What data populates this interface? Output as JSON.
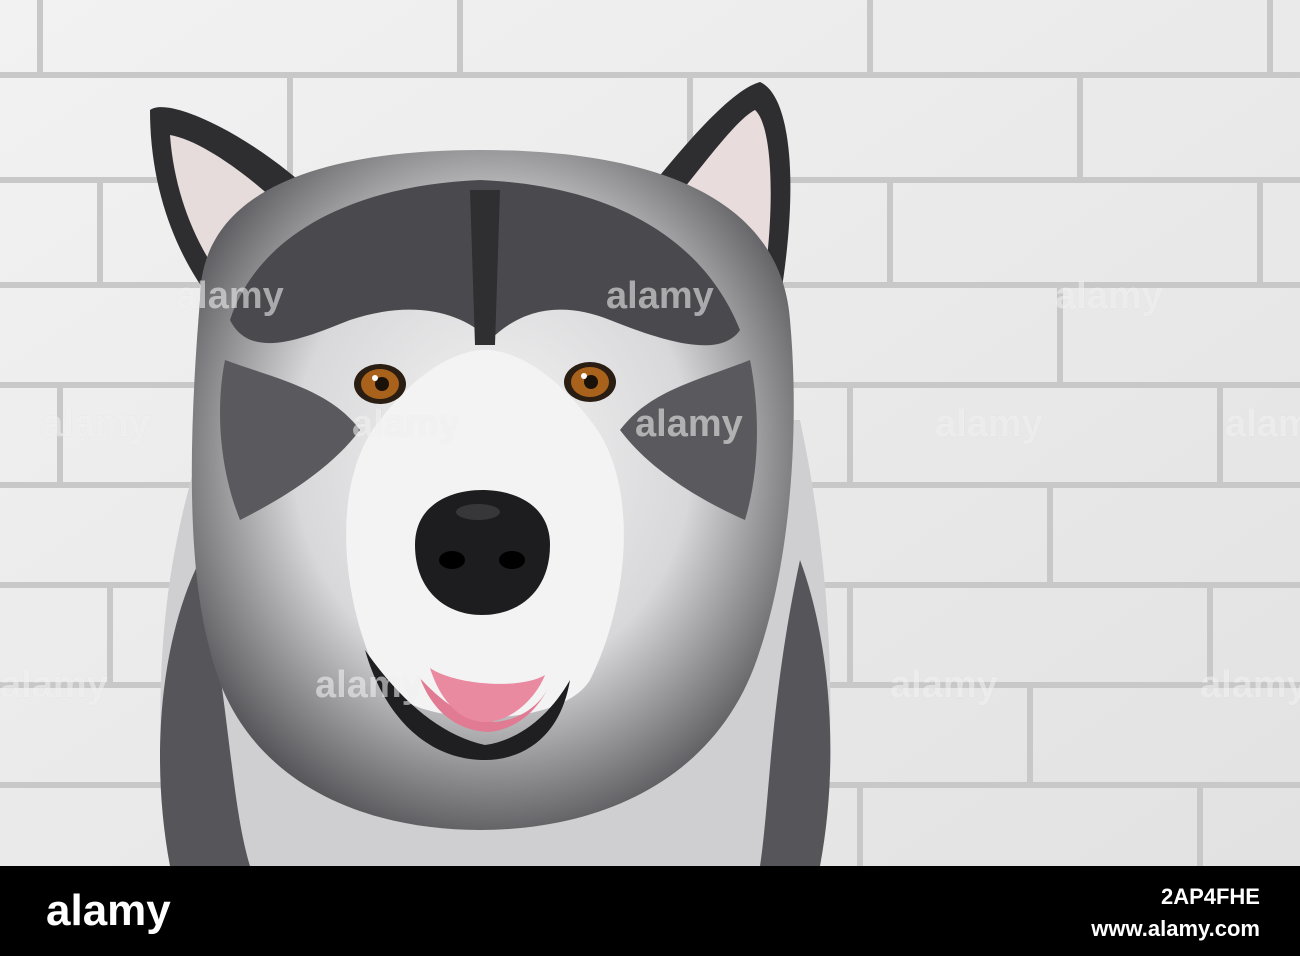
{
  "image": {
    "subject": "dog",
    "colors": {
      "wall": "#ececec",
      "mortar": "#c9c9c9",
      "fur_dark": "#3a3a3d",
      "fur_light": "#f2f2f2",
      "eye": "#a8621c",
      "tongue": "#e07b93"
    }
  },
  "watermarks": [
    "alamy",
    "alamy",
    "alamy",
    "alamy",
    "alamy",
    "alamy",
    "alamy",
    "alamy",
    "alamy",
    "alamy",
    "alamy",
    "alamy"
  ],
  "footer": {
    "brand": "alamy",
    "image_id": "2AP4FHE",
    "url": "www.alamy.com"
  }
}
